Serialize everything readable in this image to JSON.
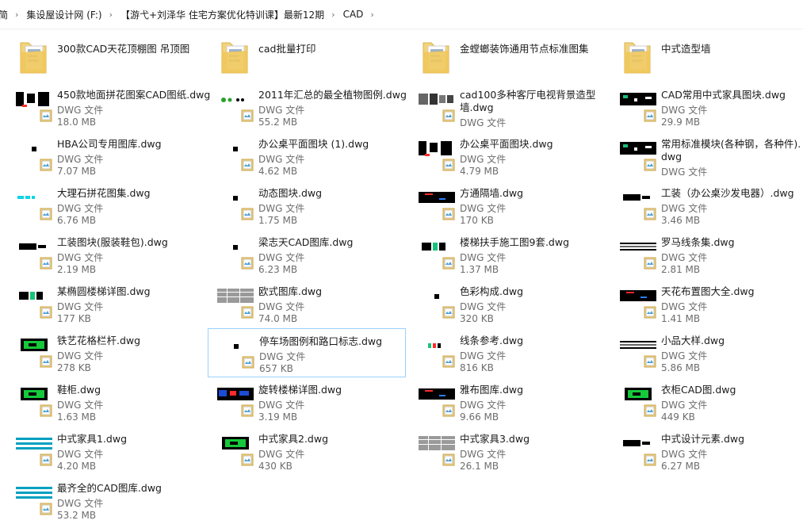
{
  "breadcrumb": [
    "简",
    "集设屋设计网 (F:)",
    "【游弋+刘泽华 住宅方案优化特训课】最新12期",
    "CAD"
  ],
  "colors": {
    "folder": "#f3d37a",
    "accent": "#99d1ff"
  },
  "folders": [
    {
      "name": "300款CAD天花顶棚图 吊顶图",
      "icon": "folder-icon"
    },
    {
      "name": "cad批量打印",
      "icon": "folder-icon"
    },
    {
      "name": "金螳螂装饰通用节点标准图集",
      "icon": "folder-icon"
    },
    {
      "name": "中式造型墙",
      "icon": "folder-icon"
    }
  ],
  "files": [
    {
      "name": "450款地面拼花图案CAD图纸.dwg",
      "type": "DWG 文件",
      "size": "18.0 MB",
      "thumb": "black-blocks"
    },
    {
      "name": "2011年汇总的最全植物图例.dwg",
      "type": "DWG 文件",
      "size": "55.2 MB",
      "thumb": "plants"
    },
    {
      "name": "cad100多种客厅电视背景造型墙.dwg",
      "type": "DWG 文件",
      "size": "",
      "size2": "DWG 文件",
      "thumb": "tv-wall"
    },
    {
      "name": "CAD常用中式家具图块.dwg",
      "type": "DWG 文件",
      "size": "29.9 MB",
      "thumb": "furniture"
    },
    {
      "name": "HBA公司专用图库.dwg",
      "type": "DWG 文件",
      "size": "7.07 MB",
      "thumb": "dot"
    },
    {
      "name": "办公桌平面图块 (1).dwg",
      "type": "DWG 文件",
      "size": "4.62 MB",
      "thumb": "dot"
    },
    {
      "name": "办公桌平面图块.dwg",
      "type": "DWG 文件",
      "size": "4.79 MB",
      "thumb": "black-blocks"
    },
    {
      "name": "常用标准模块(各种钢，各种件).dwg",
      "type": "DWG 文件",
      "size": "",
      "thumb": "furniture"
    },
    {
      "name": "大理石拼花图集.dwg",
      "type": "DWG 文件",
      "size": "6.76 MB",
      "thumb": "cyan"
    },
    {
      "name": "动态图块.dwg",
      "type": "DWG 文件",
      "size": "1.75 MB",
      "thumb": "dot"
    },
    {
      "name": "方通隔墙.dwg",
      "type": "DWG 文件",
      "size": "170 KB",
      "thumb": "black-bar"
    },
    {
      "name": "工装（办公桌沙发电器）.dwg",
      "type": "DWG 文件",
      "size": "3.46 MB",
      "thumb": "black-small"
    },
    {
      "name": "工装图块(服装鞋包).dwg",
      "type": "DWG 文件",
      "size": "2.19 MB",
      "thumb": "black-small"
    },
    {
      "name": "梁志天CAD图库.dwg",
      "type": "DWG 文件",
      "size": "6.23 MB",
      "thumb": "dot"
    },
    {
      "name": "楼梯扶手施工图9套.dwg",
      "type": "DWG 文件",
      "size": "1.37 MB",
      "thumb": "stairs"
    },
    {
      "name": "罗马线条集.dwg",
      "type": "DWG 文件",
      "size": "2.81 MB",
      "thumb": "lines"
    },
    {
      "name": "某椭圆楼梯详图.dwg",
      "type": "DWG 文件",
      "size": "177 KB",
      "thumb": "stairs"
    },
    {
      "name": "欧式图库.dwg",
      "type": "DWG 文件",
      "size": "74.0 MB",
      "thumb": "gray-grid"
    },
    {
      "name": "色彩构成.dwg",
      "type": "DWG 文件",
      "size": "320 KB",
      "thumb": "dot"
    },
    {
      "name": "天花布置图大全.dwg",
      "type": "DWG 文件",
      "size": "1.41 MB",
      "thumb": "black-bar"
    },
    {
      "name": "铁艺花格栏杆.dwg",
      "type": "DWG 文件",
      "size": "278 KB",
      "thumb": "green"
    },
    {
      "name": "停车场图例和路口标志.dwg",
      "type": "DWG 文件",
      "size": "657 KB",
      "thumb": "dot"
    },
    {
      "name": "线条参考.dwg",
      "type": "DWG 文件",
      "size": "816 KB",
      "thumb": "small-color"
    },
    {
      "name": "小品大样.dwg",
      "type": "DWG 文件",
      "size": "5.86 MB",
      "thumb": "lines"
    },
    {
      "name": "鞋柜.dwg",
      "type": "DWG 文件",
      "size": "1.63 MB",
      "thumb": "green"
    },
    {
      "name": "旋转楼梯详图.dwg",
      "type": "DWG 文件",
      "size": "3.19 MB",
      "thumb": "blue-black"
    },
    {
      "name": "雅布图库.dwg",
      "type": "DWG 文件",
      "size": "9.66 MB",
      "thumb": "black-bar"
    },
    {
      "name": "衣柜CAD图.dwg",
      "type": "DWG 文件",
      "size": "449 KB",
      "thumb": "green"
    },
    {
      "name": "中式家具1.dwg",
      "type": "DWG 文件",
      "size": "4.20 MB",
      "thumb": "teal-lines"
    },
    {
      "name": "中式家具2.dwg",
      "type": "DWG 文件",
      "size": "430 KB",
      "thumb": "green"
    },
    {
      "name": "中式家具3.dwg",
      "type": "DWG 文件",
      "size": "26.1 MB",
      "thumb": "gray-grid"
    },
    {
      "name": "中式设计元素.dwg",
      "type": "DWG 文件",
      "size": "6.27 MB",
      "thumb": "black-small"
    },
    {
      "name": "最齐全的CAD图库.dwg",
      "type": "DWG 文件",
      "size": "53.2 MB",
      "thumb": "teal-lines"
    }
  ],
  "selected_index": 21
}
